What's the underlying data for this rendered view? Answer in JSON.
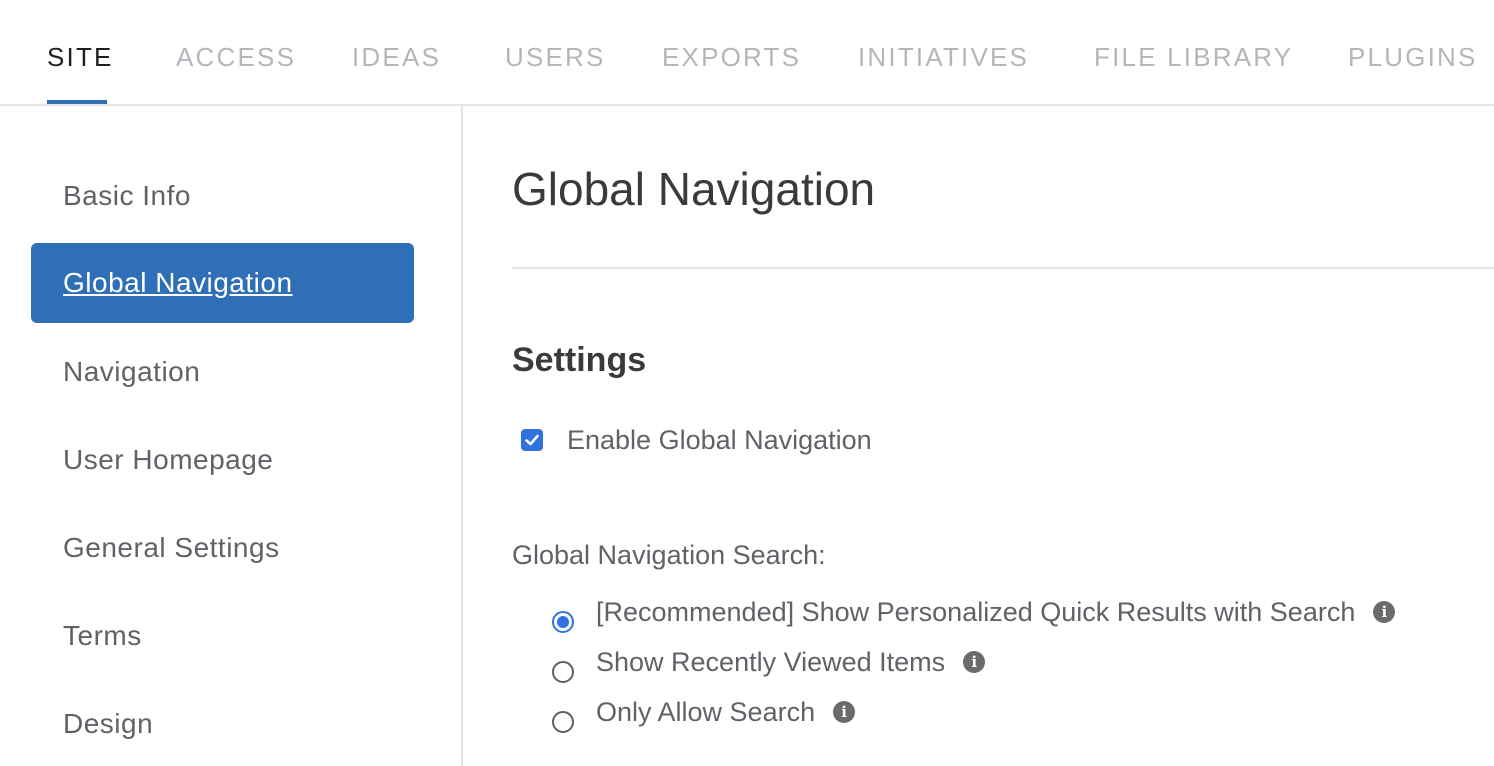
{
  "tabs": [
    {
      "label": "SITE",
      "active": true
    },
    {
      "label": "ACCESS",
      "active": false
    },
    {
      "label": "IDEAS",
      "active": false
    },
    {
      "label": "USERS",
      "active": false
    },
    {
      "label": "EXPORTS",
      "active": false
    },
    {
      "label": "INITIATIVES",
      "active": false
    },
    {
      "label": "FILE LIBRARY",
      "active": false
    },
    {
      "label": "PLUGINS",
      "active": false
    }
  ],
  "sidebar": {
    "items": [
      {
        "label": "Basic Info",
        "active": false
      },
      {
        "label": "Global Navigation",
        "active": true
      },
      {
        "label": "Navigation",
        "active": false
      },
      {
        "label": "User Homepage",
        "active": false
      },
      {
        "label": "General Settings",
        "active": false
      },
      {
        "label": "Terms",
        "active": false
      },
      {
        "label": "Design",
        "active": false
      }
    ]
  },
  "main": {
    "title": "Global Navigation",
    "section_title": "Settings",
    "enable_checkbox": {
      "label": "Enable Global Navigation",
      "checked": true
    },
    "search_field_label": "Global Navigation Search:",
    "search_options": [
      {
        "label": "[Recommended] Show Personalized Quick Results with Search",
        "checked": true,
        "icon": "info-icon"
      },
      {
        "label": "Show Recently Viewed Items",
        "checked": false,
        "icon": "info-icon"
      },
      {
        "label": "Only Allow Search",
        "checked": false,
        "icon": "info-icon"
      }
    ]
  },
  "colors": {
    "accent": "#2f6fb8",
    "control_blue": "#2f72e0",
    "inactive_tab": "#b3b7bc",
    "text_gray": "#5f6368"
  }
}
